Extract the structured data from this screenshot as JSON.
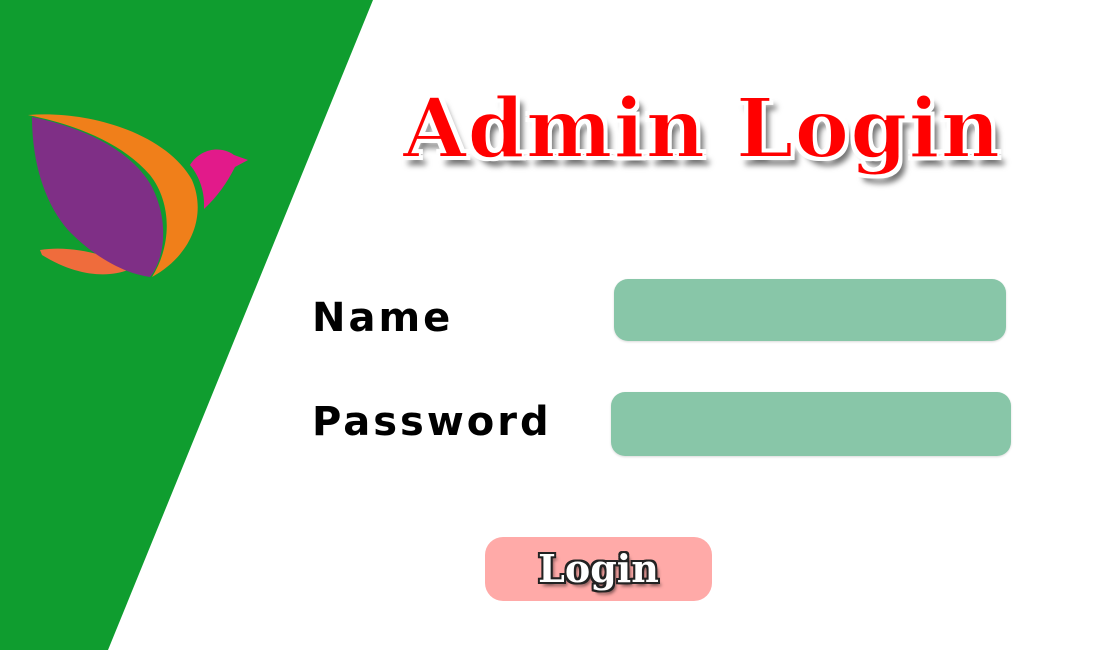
{
  "page": {
    "title": "Admin Login"
  },
  "form": {
    "name_label": "Name",
    "name_value": "",
    "password_label": "Password",
    "password_value": "",
    "submit_label": "Login"
  },
  "colors": {
    "panel_green": "#0f9d2f",
    "title_red": "#ff0000",
    "field_green": "#88c6a8",
    "button_pink": "#ffaaa8",
    "logo_purple": "#7f2f86",
    "logo_orange": "#f07f1a",
    "logo_magenta": "#e21a8a"
  },
  "icons": {
    "logo": "bird-logo-icon"
  }
}
